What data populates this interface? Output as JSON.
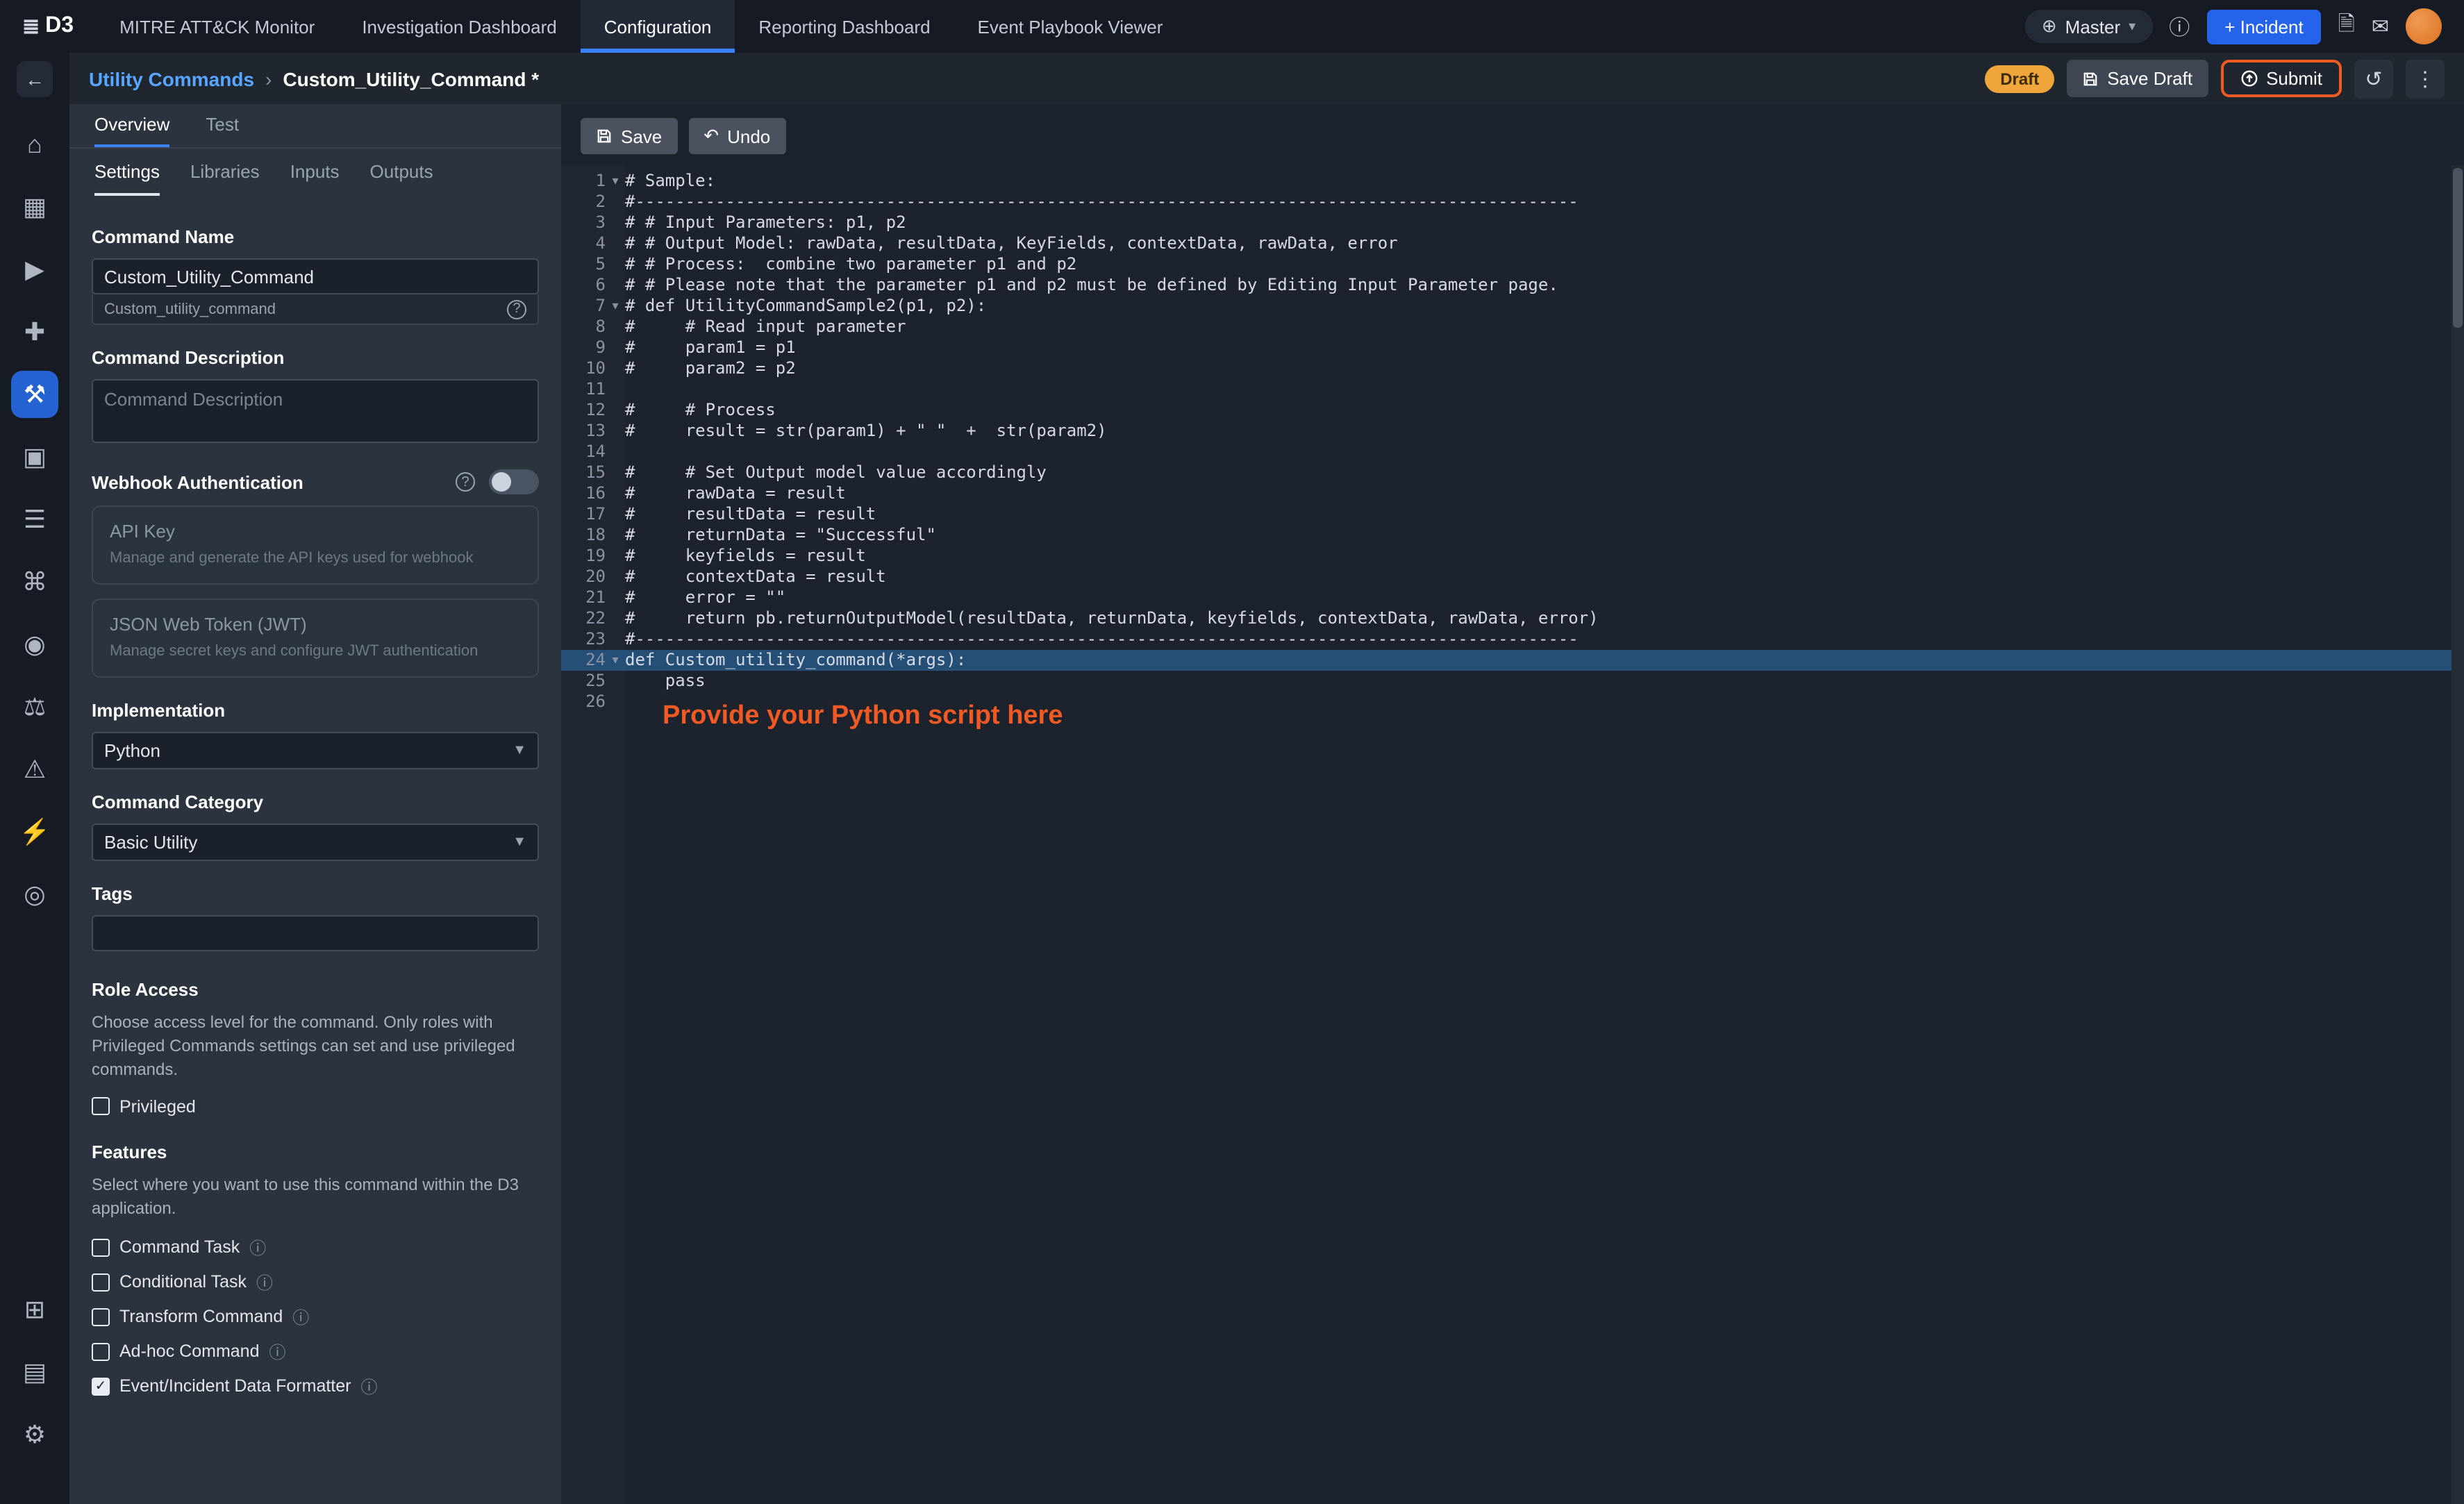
{
  "colors": {
    "accent_orange": "#f05a24",
    "draft_amber": "#f0a63a",
    "incident_blue": "#2563eb",
    "tab_blue": "#3b82f6",
    "breadcrumb_blue": "#58a6ff",
    "highlight_line": "#264f78"
  },
  "topnav": {
    "logo": "D3",
    "items": [
      {
        "label": "MITRE ATT&CK Monitor",
        "active": false
      },
      {
        "label": "Investigation Dashboard",
        "active": false
      },
      {
        "label": "Configuration",
        "active": true
      },
      {
        "label": "Reporting Dashboard",
        "active": false
      },
      {
        "label": "Event Playbook Viewer",
        "active": false
      }
    ],
    "master_label": "Master",
    "incident_button": "+ Incident"
  },
  "header": {
    "breadcrumb_parent": "Utility Commands",
    "breadcrumb_current": "Custom_Utility_Command *",
    "draft_badge": "Draft",
    "save_draft_button": "Save Draft",
    "submit_button": "Submit"
  },
  "sidebar": {
    "top_icons": [
      {
        "name": "home",
        "glyph": "⌂",
        "active": false
      },
      {
        "name": "calendar",
        "glyph": "▦",
        "active": false
      },
      {
        "name": "playbook",
        "glyph": "▶",
        "active": false
      },
      {
        "name": "integrations",
        "glyph": "✚",
        "active": false
      },
      {
        "name": "utility-commands",
        "glyph": "⚒",
        "active": true
      },
      {
        "name": "apps",
        "glyph": "▣",
        "active": false
      },
      {
        "name": "data-stack",
        "glyph": "☰",
        "active": false
      },
      {
        "name": "connections",
        "glyph": "⌘",
        "active": false
      },
      {
        "name": "broadcast",
        "glyph": "◉",
        "active": false
      },
      {
        "name": "compliance-scale",
        "glyph": "⚖",
        "active": false
      },
      {
        "name": "alert-triangle",
        "glyph": "⚠",
        "active": false
      },
      {
        "name": "automation",
        "glyph": "⚡",
        "active": false
      },
      {
        "name": "fingerprint",
        "glyph": "◎",
        "active": false
      }
    ],
    "bottom_icons": [
      {
        "name": "pages",
        "glyph": "⊞",
        "active": false
      },
      {
        "name": "folder",
        "glyph": "▤",
        "active": false
      },
      {
        "name": "settings-gear",
        "glyph": "⚙",
        "active": false
      }
    ]
  },
  "form": {
    "tabs": [
      {
        "label": "Overview",
        "active": true
      },
      {
        "label": "Test",
        "active": false
      }
    ],
    "subtabs": [
      {
        "label": "Settings",
        "active": true
      },
      {
        "label": "Libraries",
        "active": false
      },
      {
        "label": "Inputs",
        "active": false
      },
      {
        "label": "Outputs",
        "active": false
      }
    ],
    "command_name_label": "Command Name",
    "command_name_value": "Custom_Utility_Command",
    "command_name_hint": "Custom_utility_command",
    "command_description_label": "Command Description",
    "command_description_placeholder": "Command Description",
    "webhook_label": "Webhook Authentication",
    "api_key_title": "API Key",
    "api_key_desc": "Manage and generate the API keys used for webhook",
    "jwt_title": "JSON Web Token (JWT)",
    "jwt_desc": "Manage secret keys and configure JWT authentication",
    "implementation_label": "Implementation",
    "implementation_value": "Python",
    "category_label": "Command Category",
    "category_value": "Basic Utility",
    "tags_label": "Tags",
    "role_access_label": "Role Access",
    "role_access_desc": "Choose access level for the command. Only roles with Privileged Commands settings can set and use privileged commands.",
    "privileged_label": "Privileged",
    "features_label": "Features",
    "features_desc": "Select where you want to use this command within the D3 application.",
    "features": [
      {
        "label": "Command Task",
        "checked": false,
        "info": true
      },
      {
        "label": "Conditional Task",
        "checked": false,
        "info": true
      },
      {
        "label": "Transform Command",
        "checked": false,
        "info": true
      },
      {
        "label": "Ad-hoc Command",
        "checked": false,
        "info": true
      },
      {
        "label": "Event/Incident Data Formatter",
        "checked": true,
        "info": true
      }
    ]
  },
  "editor": {
    "save_button": "Save",
    "undo_button": "Undo",
    "annotation": "Provide your Python script here",
    "highlight_line": 24,
    "fold_lines": [
      1,
      7,
      24
    ],
    "lines": [
      "# Sample:",
      "#----------------------------------------------------------------------------------------------",
      "# # Input Parameters: p1, p2",
      "# # Output Model: rawData, resultData, KeyFields, contextData, rawData, error",
      "# # Process:  combine two parameter p1 and p2",
      "# # Please note that the parameter p1 and p2 must be defined by Editing Input Parameter page.",
      "# def UtilityCommandSample2(p1, p2):",
      "#     # Read input parameter",
      "#     param1 = p1",
      "#     param2 = p2",
      "",
      "#     # Process",
      "#     result = str(param1) + \" \"  +  str(param2)",
      "",
      "#     # Set Output model value accordingly",
      "#     rawData = result",
      "#     resultData = result",
      "#     returnData = \"Successful\"",
      "#     keyfields = result",
      "#     contextData = result",
      "#     error = \"\"",
      "#     return pb.returnOutputModel(resultData, returnData, keyfields, contextData, rawData, error)",
      "#----------------------------------------------------------------------------------------------",
      "def Custom_utility_command(*args):",
      "    pass",
      ""
    ]
  }
}
